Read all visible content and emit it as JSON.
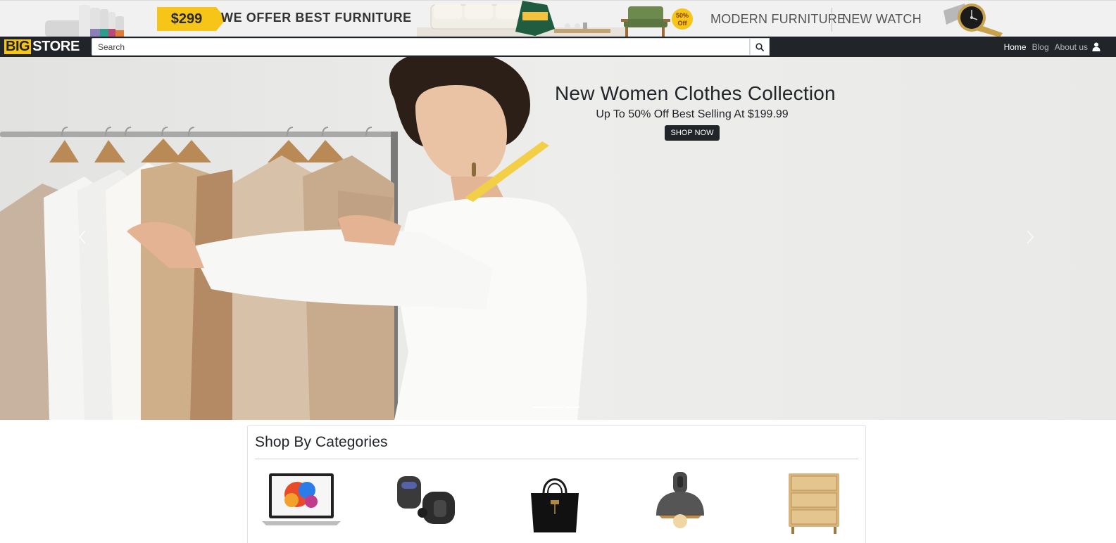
{
  "promo": {
    "price": "$299",
    "headline": "WE OFFER BEST FURNITURE",
    "discount_line1": "50%",
    "discount_line2": "Off",
    "tagline_left": "MODERN FURNITURE",
    "tagline_right": "NEW WATCH"
  },
  "navbar": {
    "logo_big": "BIG",
    "logo_store": "STORE",
    "search_placeholder": "Search",
    "links": [
      "Home",
      "Blog",
      "About us"
    ]
  },
  "hero": {
    "title": "New Women Clothes Collection",
    "subtitle": "Up To 50% Off Best Selling At $199.99",
    "cta_label": "SHOP NOW",
    "prev_icon": "chevron-left-icon",
    "next_icon": "chevron-right-icon",
    "slide_count": 3,
    "active_slide": 1
  },
  "categories": {
    "title": "Shop By Categories",
    "items": [
      {
        "icon": "laptop-icon"
      },
      {
        "icon": "earbuds-icon"
      },
      {
        "icon": "handbag-icon"
      },
      {
        "icon": "pendant-lamp-icon"
      },
      {
        "icon": "drawer-cabinet-icon"
      }
    ]
  },
  "colors": {
    "accent_yellow": "#f7c418",
    "navbar_dark": "#212529"
  }
}
